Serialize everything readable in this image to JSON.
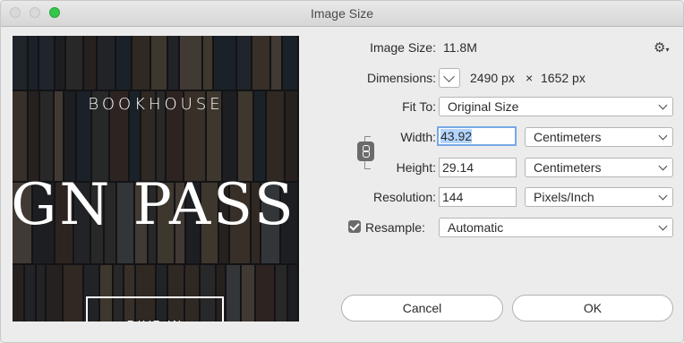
{
  "window": {
    "title": "Image Size"
  },
  "preview": {
    "brand": "BOOKHOUSE",
    "headline": "IGN PASS",
    "cta": "DIVE IN"
  },
  "fields": {
    "image_size_label": "Image Size:",
    "image_size_value": "11.8M",
    "dimensions_label": "Dimensions:",
    "dim_width": "2490 px",
    "dim_times": "×",
    "dim_height": "1652 px",
    "fit_to_label": "Fit To:",
    "fit_to_value": "Original Size",
    "width_label": "Width:",
    "width_value": "43.92",
    "width_unit": "Centimeters",
    "height_label": "Height:",
    "height_value": "29.14",
    "height_unit": "Centimeters",
    "resolution_label": "Resolution:",
    "resolution_value": "144",
    "resolution_unit": "Pixels/Inch",
    "resample_label": "Resample:",
    "resample_checked": true,
    "resample_value": "Automatic"
  },
  "buttons": {
    "cancel": "Cancel",
    "ok": "OK"
  },
  "icons": {
    "settings": "gear-icon",
    "link": "chain-link-icon",
    "dimensions_toggle": "chevron-down-icon"
  },
  "colors": {
    "zoom_button": "#34c749",
    "focus_ring": "#76a9e6",
    "selection": "#b3d4fd"
  }
}
